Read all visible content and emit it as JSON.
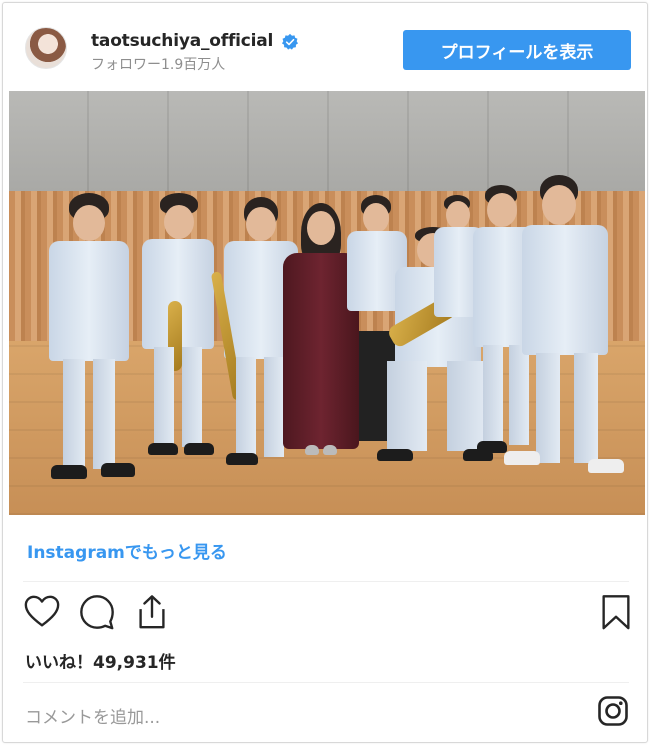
{
  "header": {
    "username": "taotsuchiya_official",
    "followers": "フォロワー1.9百万人",
    "profile_button": "プロフィールを表示",
    "verified_icon": "verified-badge-icon",
    "avatar_icon": "profile-avatar"
  },
  "post": {
    "image_icon": "group-photo",
    "more_link": "Instagramでもっと見る",
    "likes": "いいね！49,931件",
    "comment_placeholder": "コメントを追加...",
    "actions": {
      "like_icon": "heart-icon",
      "comment_icon": "comment-icon",
      "share_icon": "share-icon",
      "save_icon": "bookmark-icon",
      "instagram_icon": "instagram-icon"
    }
  },
  "colors": {
    "accent": "#3897f0",
    "text": "#262626",
    "muted": "#8e8e8e"
  }
}
